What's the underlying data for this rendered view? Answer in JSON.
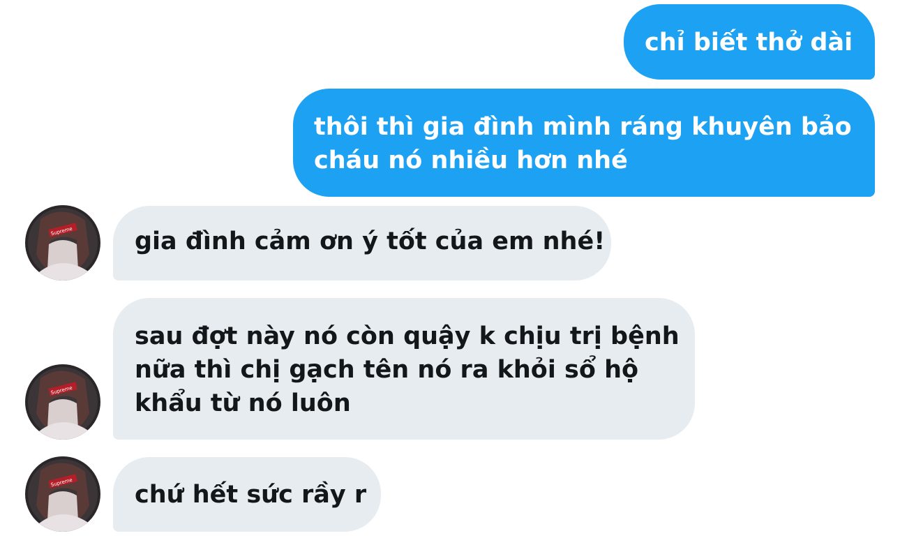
{
  "messages": [
    {
      "direction": "sent",
      "lines": [
        "chỉ biết thở dài"
      ]
    },
    {
      "direction": "sent",
      "lines": [
        "thôi thì gia đình mình ráng khuyên bảo",
        "cháu nó nhiều hơn nhé"
      ]
    },
    {
      "direction": "received",
      "lines": [
        "gia đình cảm ơn ý tốt của em nhé!"
      ]
    },
    {
      "direction": "received",
      "lines": [
        "sau đợt này nó còn quậy k chịu trị bệnh",
        "nữa thì chị gạch tên nó ra khỏi sổ hộ",
        "khẩu từ nó luôn"
      ]
    },
    {
      "direction": "received",
      "lines": [
        "chứ hết sức rầy r"
      ]
    }
  ],
  "avatar": {
    "icon": "user-avatar-icon",
    "brand_text": "Supreme"
  },
  "colors": {
    "sent_bubble": "#1da1f2",
    "sent_text": "#ffffff",
    "received_bubble": "#e6ecf0",
    "received_text": "#14171a"
  }
}
